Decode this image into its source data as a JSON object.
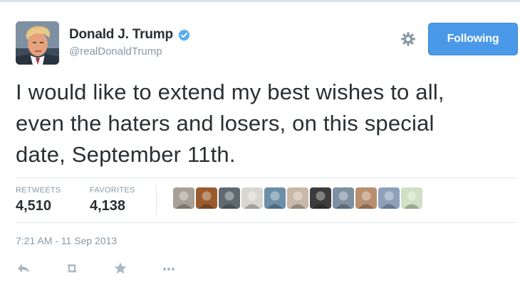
{
  "profile": {
    "full_name": "Donald J. Trump",
    "screen_name": "@realDonaldTrump",
    "verified": true,
    "avatar_icon": "profile-avatar"
  },
  "header": {
    "settings_icon": "gear-icon",
    "follow_button_label": "Following",
    "follow_button_color": "#4a99e9"
  },
  "tweet": {
    "text_lines": [
      "I would like to extend my best wishes to all,",
      "even the haters and losers, on this special",
      "date, September 11th."
    ],
    "timestamp": "7:21 AM - 11 Sep 2013"
  },
  "stats": {
    "retweets_label": "RETWEETS",
    "retweets_value": "4,510",
    "favorites_label": "FAVORITES",
    "favorites_value": "4,138"
  },
  "favorited_by": [
    {
      "icon": "user-avatar",
      "color": "#a8a096"
    },
    {
      "icon": "user-avatar",
      "color": "#9a5a2c"
    },
    {
      "icon": "user-avatar",
      "color": "#5f6a70"
    },
    {
      "icon": "user-avatar",
      "color": "#d8d6d0"
    },
    {
      "icon": "user-avatar",
      "color": "#6c8fa8"
    },
    {
      "icon": "user-avatar",
      "color": "#c9b7a8"
    },
    {
      "icon": "user-avatar",
      "color": "#3c3c3c"
    },
    {
      "icon": "user-avatar",
      "color": "#7d8fa0"
    },
    {
      "icon": "user-avatar",
      "color": "#b98f6e"
    },
    {
      "icon": "user-avatar",
      "color": "#8fa0bb"
    },
    {
      "icon": "user-avatar",
      "color": "#cfe0c4"
    }
  ],
  "actions": [
    {
      "icon": "reply-icon"
    },
    {
      "icon": "retweet-icon"
    },
    {
      "icon": "favorite-star-icon"
    },
    {
      "icon": "more-options-icon"
    }
  ]
}
